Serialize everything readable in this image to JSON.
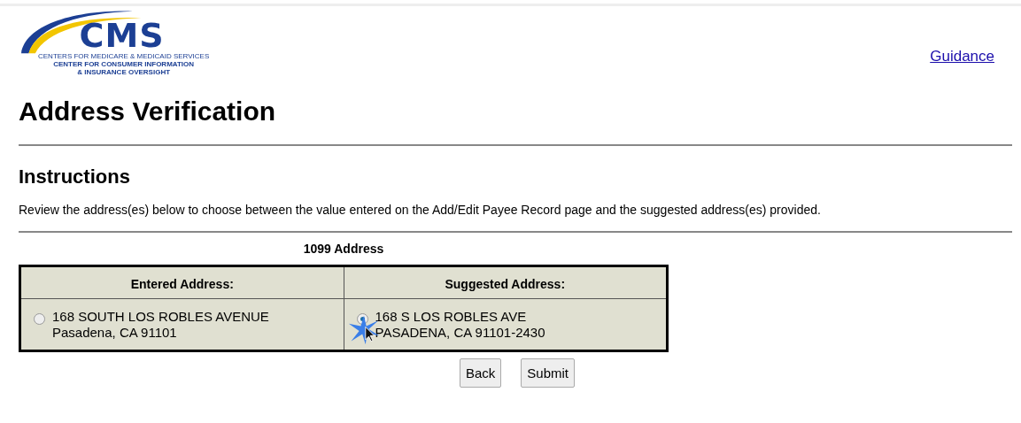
{
  "header": {
    "logo": {
      "wordmark": "CMS",
      "line_1": "CENTERS FOR MEDICARE & MEDICAID SERVICES",
      "line_2": "CENTER FOR CONSUMER INFORMATION",
      "line_3": "& INSURANCE OVERSIGHT"
    },
    "link": "Guidance"
  },
  "title": "Address Verification",
  "instructions": {
    "heading": "Instructions",
    "text": "Review the address(es) below to choose between the value entered on the Add/Edit Payee Record page and the suggested address(es) provided."
  },
  "address_table": {
    "caption": "1099 Address",
    "columns": [
      "Entered Address:",
      "Suggested Address:"
    ],
    "options": [
      {
        "line_1": "168 SOUTH LOS ROBLES AVENUE",
        "line_2": "Pasadena, CA 91101",
        "selected": false
      },
      {
        "line_1": "168 S LOS ROBLES AVE",
        "line_2": "PASADENA, CA 91101-2430",
        "selected": true
      }
    ]
  },
  "buttons": [
    "Back",
    "Submit"
  ]
}
